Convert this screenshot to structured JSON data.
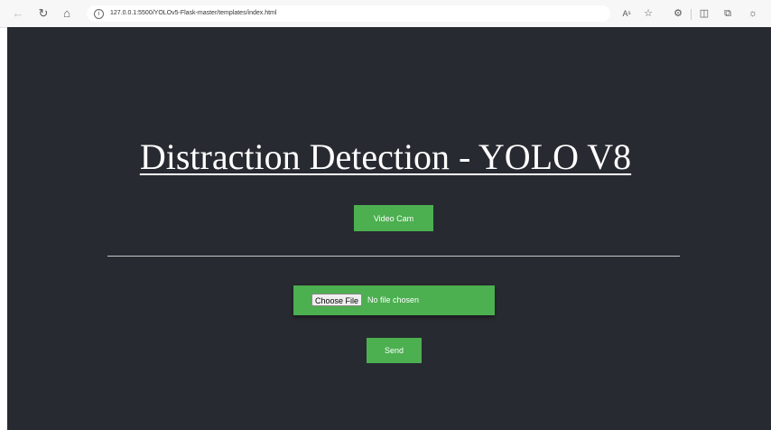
{
  "browser": {
    "url": "127.0.0.1:5500/YOLOv5-Flask-master/templates/index.html",
    "read_aloud_label": "Aˢ"
  },
  "page": {
    "title": "Distraction Detection - YOLO V8",
    "video_button_label": "Video Cam",
    "choose_file_label": "Choose File",
    "file_status": "No file chosen",
    "send_button_label": "Send"
  },
  "colors": {
    "page_background": "#282a31",
    "button_green": "#4caf50"
  }
}
